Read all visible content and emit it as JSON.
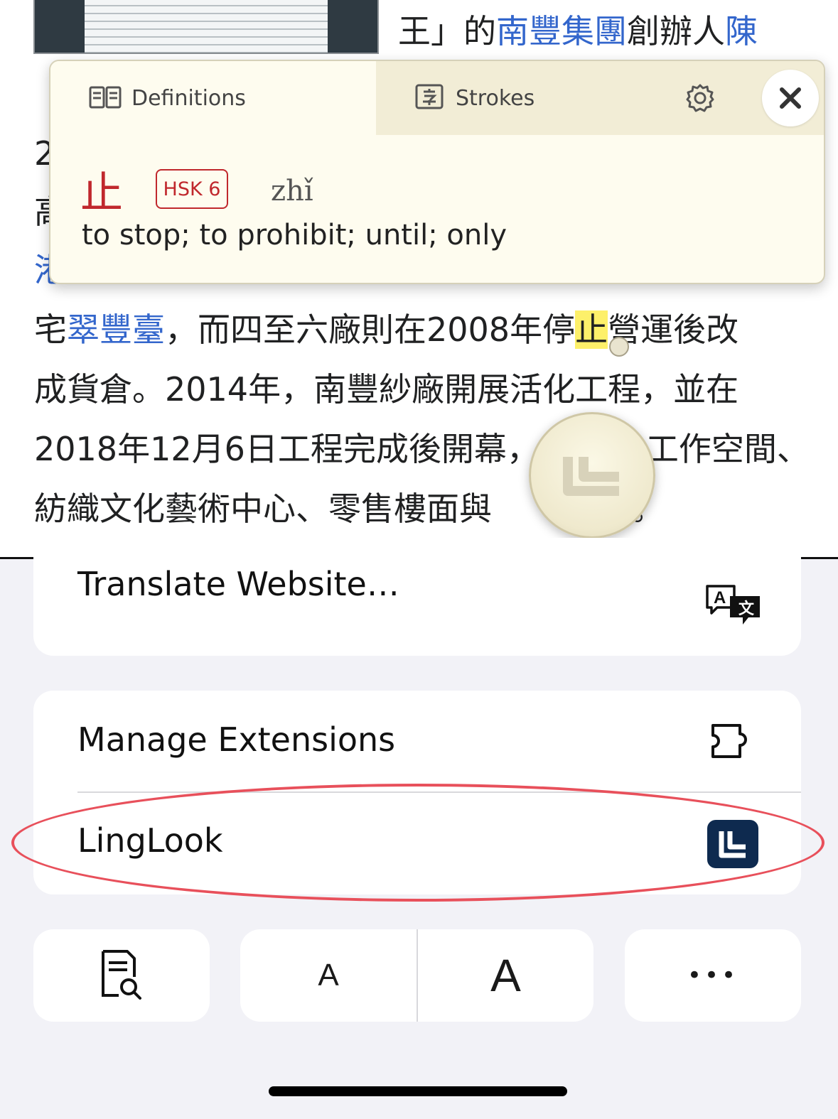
{
  "article": {
    "line0_pre": "王」的",
    "line0_link1": "南豐集團",
    "line0_mid": "創辦人",
    "line0_link2": "陳",
    "line1": "2",
    "line2": "高",
    "line3_link": "港",
    "line4_pre": "宅",
    "line4_link": "翠豐臺",
    "line4_mid": "，而四至六廠則在2008年停",
    "line4_hl": "止",
    "line4_post": "營運後改",
    "line5": "成貨倉。2014年，南豐紗廠開展活化工程，並在",
    "line6_pre": "2018年12月6日工程完成後開幕，",
    "line6_post": "工作空間、",
    "line7_pre": "紡織文化藝術中心、零售樓面與",
    "line7_post": "間。"
  },
  "popup": {
    "tabs": {
      "definitions": "Definitions",
      "strokes": "Strokes"
    },
    "entry": {
      "hanzi": "止",
      "hsk": "HSK 6",
      "pinyin": "zhǐ",
      "gloss": "to stop; to prohibit; until; only"
    }
  },
  "menu": {
    "translate": "Translate Website…",
    "manage_extensions": "Manage Extensions",
    "linglook": "LingLook"
  },
  "toolbar": {
    "font_small": "A",
    "font_large": "A",
    "more": "•••"
  },
  "colors": {
    "link": "#3366cc",
    "highlight": "#fdf06a",
    "popup_bg": "#fefcef",
    "hanzi_red": "#c0282d",
    "annotation_red": "#e8505b",
    "linglook_icon_bg": "#0e2a4f"
  },
  "icons": {
    "definitions": "book-icon",
    "strokes": "character-icon",
    "settings": "gear-icon",
    "close": "close-icon",
    "translate": "translate-icon",
    "extensions": "puzzle-icon",
    "linglook": "linglook-logo",
    "reader": "reader-search-icon",
    "more": "ellipsis-icon"
  }
}
